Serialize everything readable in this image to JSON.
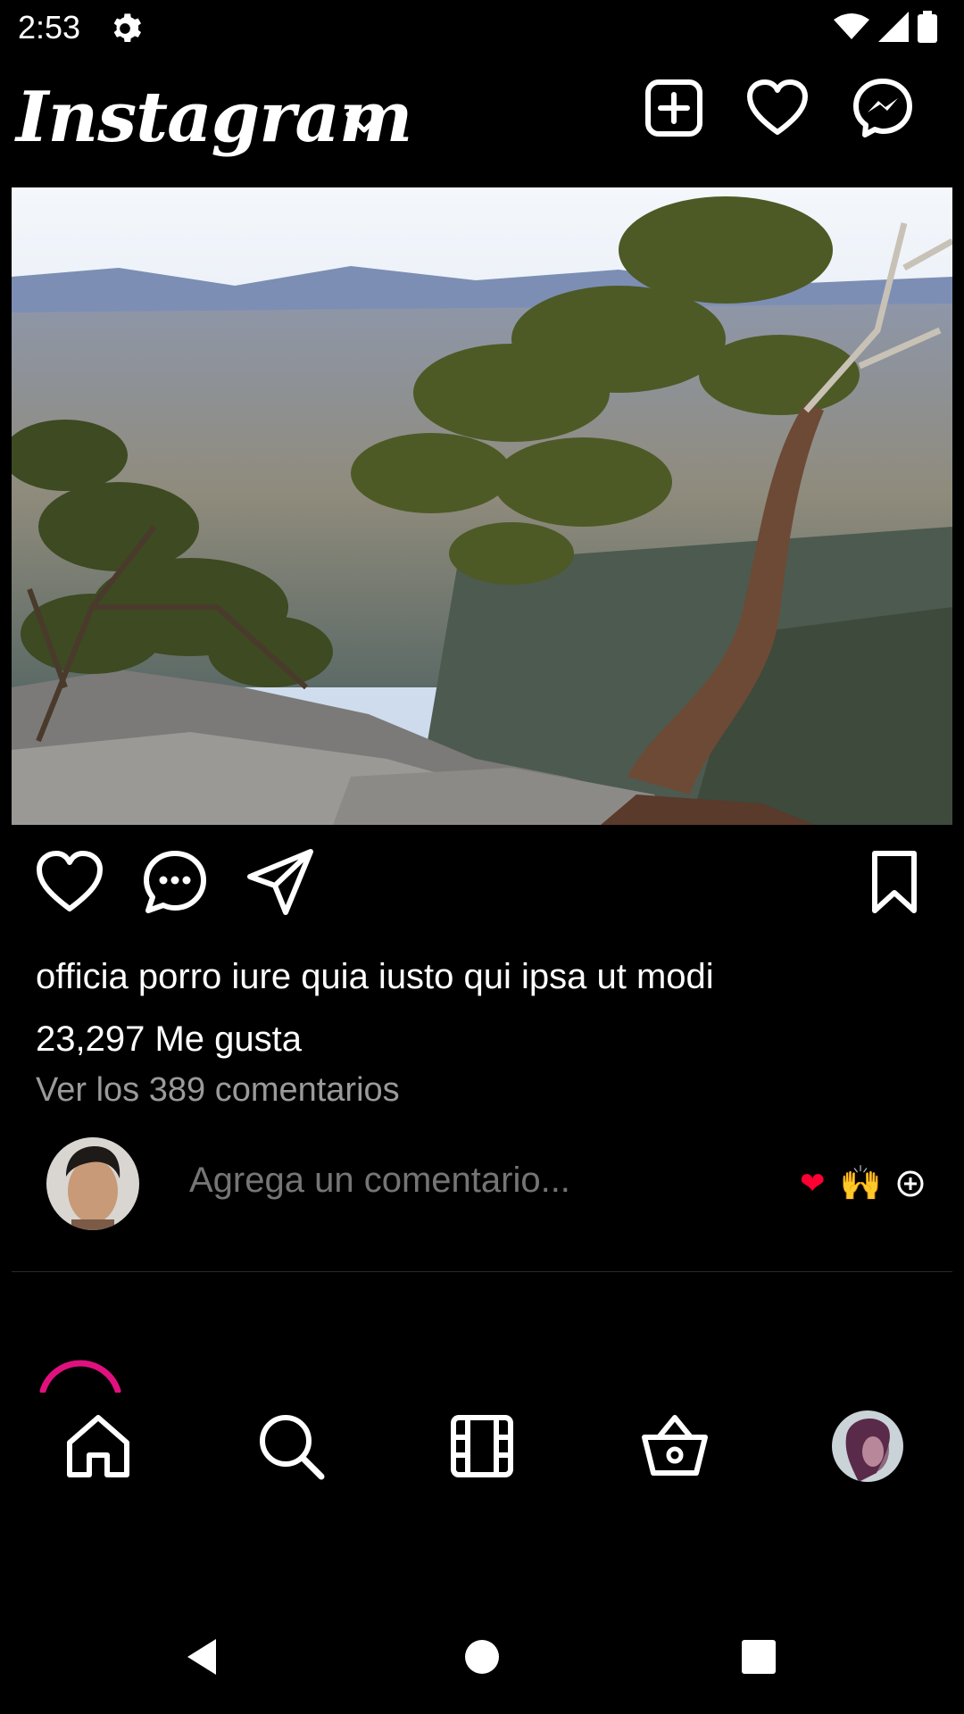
{
  "status_bar": {
    "time": "2:53"
  },
  "header": {
    "logo": "Instagram"
  },
  "post": {
    "caption": "officia porro iure quia iusto qui ipsa ut modi",
    "likes": "23,297 Me gusta",
    "comments_link": "Ver los 389 comentarios"
  },
  "comment_box": {
    "placeholder": "Agrega un comentario...",
    "reactions": [
      "❤",
      "🙌"
    ]
  },
  "colors": {
    "background": "#000000",
    "accent_spinner": "#E0117E",
    "muted_text": "#9A9A9A",
    "heart_red": "#FF0033"
  },
  "icons": {
    "top": [
      "add-post-icon",
      "heart-icon",
      "messenger-icon"
    ],
    "actions": [
      "like-icon",
      "comment-icon",
      "share-icon",
      "bookmark-icon"
    ],
    "bottom_nav": [
      "home-icon",
      "search-icon",
      "reels-icon",
      "shop-icon",
      "profile-avatar"
    ],
    "system_nav": [
      "back-icon",
      "home-circle-icon",
      "recents-icon"
    ]
  }
}
